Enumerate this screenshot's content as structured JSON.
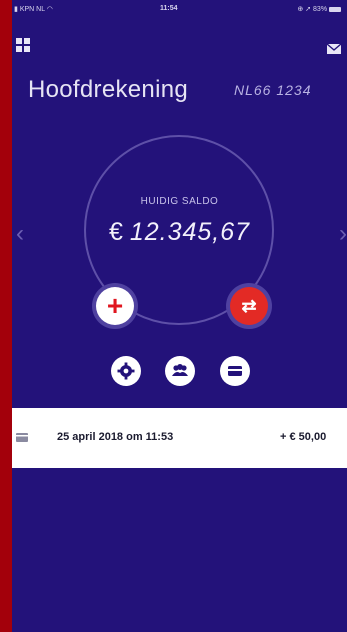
{
  "status_bar": {
    "carrier": "KPN NL",
    "time": "11:54",
    "battery": "83%"
  },
  "header": {
    "menu_icon": "grid-icon",
    "mail_icon": "envelope-icon"
  },
  "account": {
    "title": "Hoofdrekening",
    "number": "NL66 1234"
  },
  "balance": {
    "label": "HUIDIG SALDO",
    "currency": "€",
    "amount": "12.345,67"
  },
  "actions": {
    "add": "+",
    "transfer": "⇄"
  },
  "quick_icons": [
    "settings-icon",
    "people-icon",
    "card-icon"
  ],
  "transactions": [
    {
      "date": "25 april 2018 om 11:53",
      "amount": "+ € 50,00"
    }
  ],
  "colors": {
    "background": "#23127a",
    "frame": "#a3000b",
    "accent": "#e32a25"
  }
}
